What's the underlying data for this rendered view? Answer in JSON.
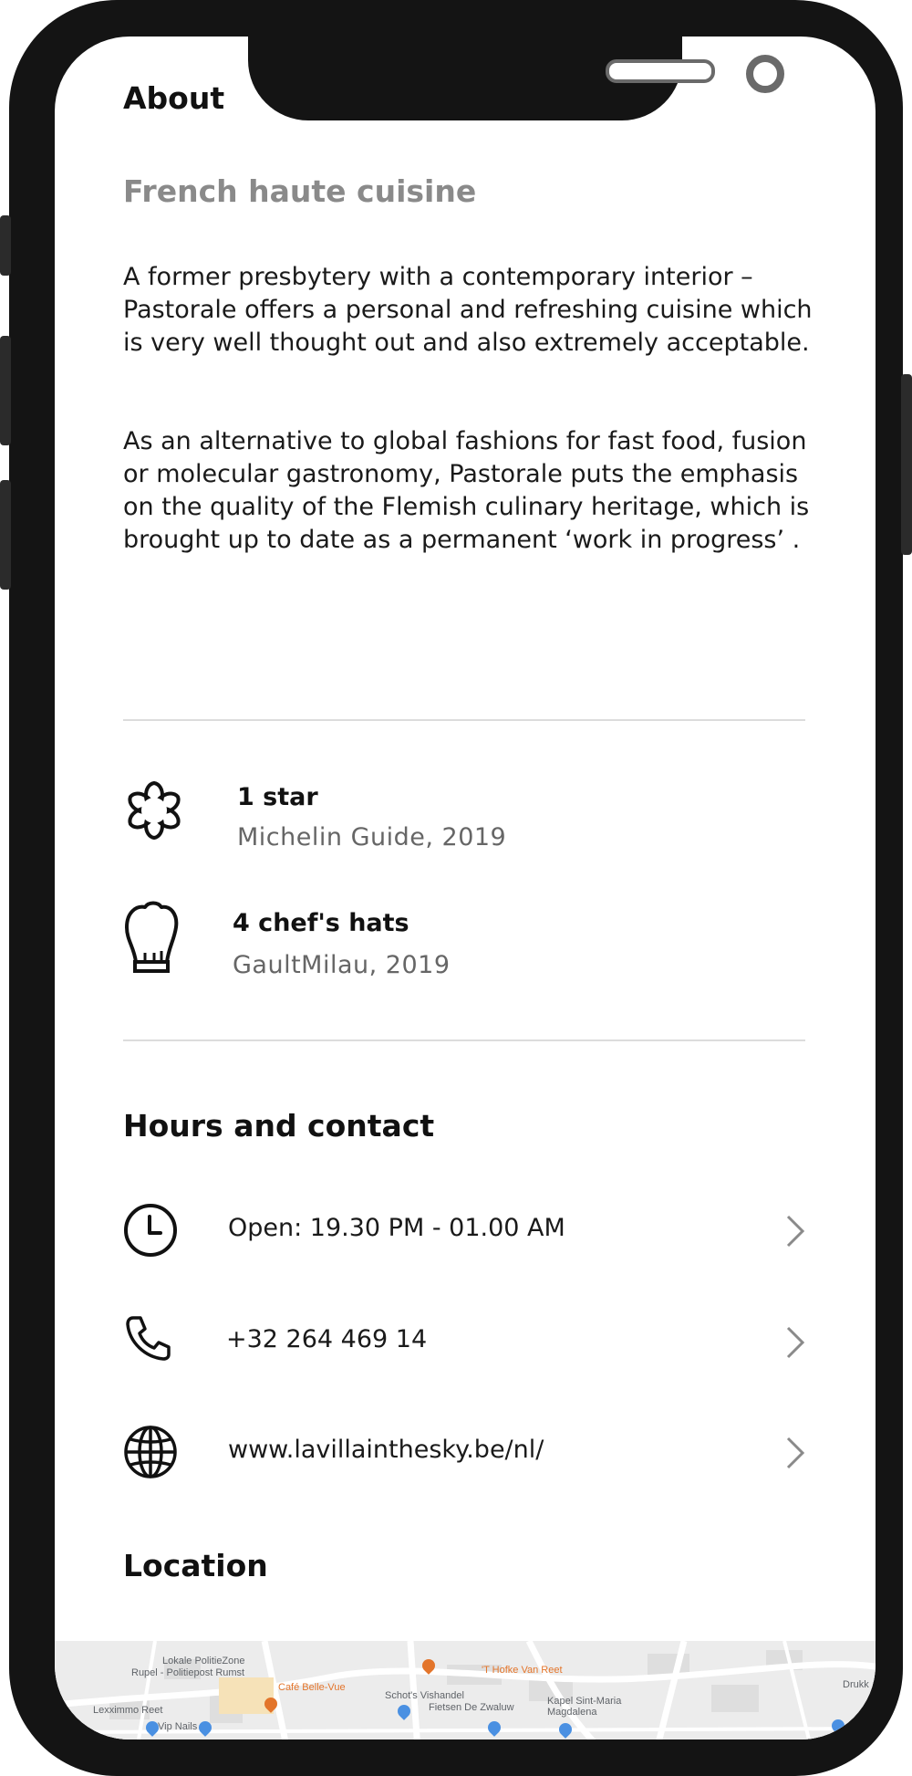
{
  "about": {
    "title": "About",
    "subtitle": "French haute cuisine",
    "paragraphs": [
      "A former presbytery with a contemporary interior – Pastorale offers a personal and refreshing cuisine which is very well thought out and also extremely acceptable.",
      "As an alternative to global fashions for fast food, fusion or molecular gastronomy, Pastorale puts the emphasis on the quality of the Flemish culinary heritage, which is brought up to date as a permanent ‘work in progress’ ."
    ]
  },
  "awards": [
    {
      "icon": "michelin-star-icon",
      "title": "1 star",
      "subtitle": "Michelin Guide, 2019"
    },
    {
      "icon": "chef-hat-icon",
      "title": "4 chef's hats",
      "subtitle": "GaultMilau, 2019"
    }
  ],
  "contact": {
    "title": "Hours and contact",
    "rows": [
      {
        "icon": "clock-icon",
        "text": "Open: 19.30 PM - 01.00 AM"
      },
      {
        "icon": "phone-icon",
        "text": "+32 264 469 14"
      },
      {
        "icon": "globe-icon",
        "text": "www.lavillainthesky.be/nl/"
      }
    ]
  },
  "location": {
    "title": "Location",
    "map_labels": [
      "Lokale PolitieZone",
      "Rupel - Politiepost Rumst",
      "Lexximmo Reet",
      "Vip Nails",
      "Café Belle-Vue",
      "'T Hofke Van Reet",
      "Schot's Vishandel",
      "Fietsen De Zwaluw",
      "Kapel Sint-Maria",
      "Magdalena",
      "Drukk"
    ]
  },
  "colors": {
    "frame": "#141414",
    "text": "#111111",
    "muted": "#8a8a8a",
    "divider": "#dcdcdc",
    "map_orange": "#e3752b",
    "map_blue": "#4a90e2",
    "map_pin": "#e53935"
  }
}
